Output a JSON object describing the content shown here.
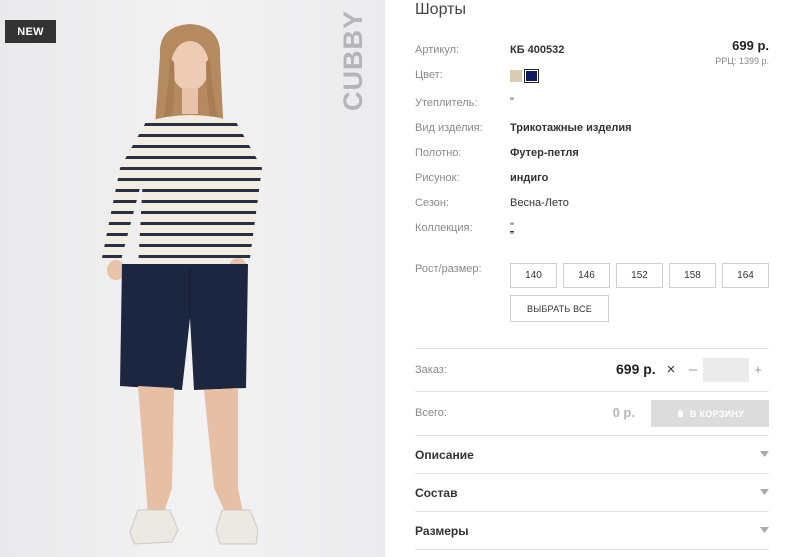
{
  "badge": "NEW",
  "brand": "CUBBY",
  "product": {
    "title": "Шорты",
    "price": "699 р.",
    "rrp": "РРЦ: 1399 р."
  },
  "attributes": [
    {
      "label": "Артикул:",
      "value": "КБ 400532"
    },
    {
      "label": "Цвет:",
      "value": ""
    },
    {
      "label": "Утеплитель:",
      "value": "\""
    },
    {
      "label": "Вид изделия:",
      "value": "Трикотажные изделия"
    },
    {
      "label": "Полотно:",
      "value": "Футер-петля"
    },
    {
      "label": "Рисунок:",
      "value": "индиго"
    },
    {
      "label": "Сезон:",
      "value": "Весна-Лето"
    },
    {
      "label": "Коллекция:",
      "value": "\"",
      "value2": "\""
    },
    {
      "label": "Рост/размер:",
      "value": ""
    }
  ],
  "colors": {
    "swatch_beige": "#d9ccb0",
    "swatch_navy": "#0d1b5e"
  },
  "sizes": [
    "140",
    "146",
    "152",
    "158",
    "164"
  ],
  "select_all_label": "ВЫБРАТЬ ВСЕ",
  "order": {
    "label": "Заказ:",
    "price": "699 р.",
    "times_icon": "×",
    "minus_icon": "–",
    "plus_icon": "+",
    "quantity": ""
  },
  "total": {
    "label": "Всего:",
    "value": "0 р.",
    "cart_label": "В КОРЗИНУ"
  },
  "accordion": [
    "Описание",
    "Состав",
    "Размеры"
  ]
}
